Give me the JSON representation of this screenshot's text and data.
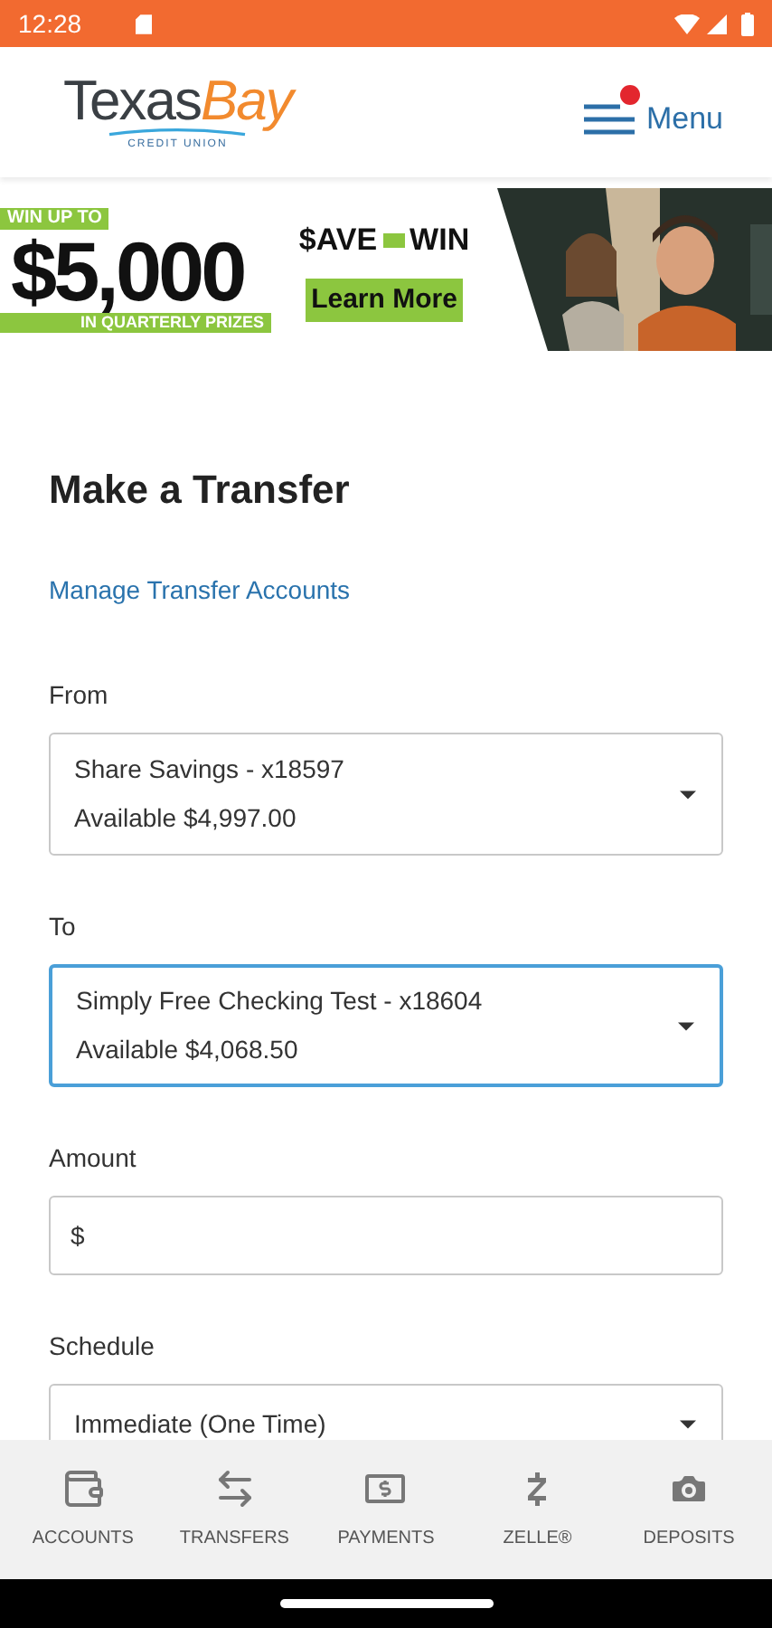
{
  "status_bar": {
    "time": "12:28"
  },
  "header": {
    "logo": {
      "name": "Texas",
      "accent": "Bay",
      "sub": "CREDIT UNION"
    },
    "menu": {
      "label": "Menu",
      "notification": true
    }
  },
  "banner": {
    "kicker": "WIN UP TO",
    "amount": "$5,000",
    "caption": "IN QUARTERLY PRIZES",
    "brand_left": "$AVE",
    "brand_right": "WIN",
    "button": "Learn More"
  },
  "page": {
    "title": "Make a Transfer",
    "link": "Manage Transfer Accounts"
  },
  "fields": [
    {
      "kind": "select",
      "label": "From",
      "value": "Share Savings - x18597",
      "detail": "Available $4,997.00",
      "focused": false
    },
    {
      "kind": "select",
      "label": "To",
      "value": "Simply Free Checking Test - x18604",
      "detail": "Available $4,068.50",
      "focused": true
    },
    {
      "kind": "input",
      "label": "Amount",
      "value": "$",
      "focused": false
    },
    {
      "kind": "select",
      "label": "Schedule",
      "value": "Immediate (One Time)",
      "focused": false
    }
  ],
  "bottom_nav": [
    {
      "label": "ACCOUNTS"
    },
    {
      "label": "TRANSFERS"
    },
    {
      "label": "PAYMENTS"
    },
    {
      "label": "ZELLE®"
    },
    {
      "label": "DEPOSITS"
    }
  ]
}
